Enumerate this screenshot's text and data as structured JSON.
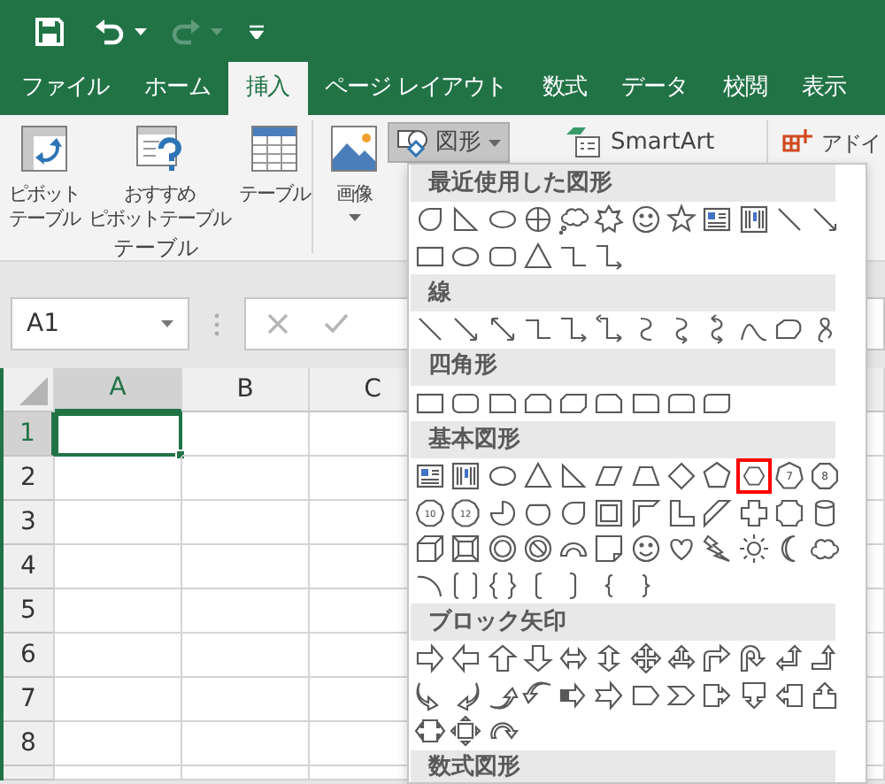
{
  "quick_access": [
    {
      "kind": "save",
      "disabled": false
    },
    {
      "kind": "undo",
      "disabled": false
    },
    {
      "kind": "redo",
      "disabled": true
    },
    {
      "kind": "customize",
      "disabled": false
    }
  ],
  "tabs": [
    {
      "label": "ファイル",
      "selected": false
    },
    {
      "label": "ホーム",
      "selected": false
    },
    {
      "label": "挿入",
      "selected": true
    },
    {
      "label": "ページ レイアウト",
      "selected": false
    },
    {
      "label": "数式",
      "selected": false
    },
    {
      "label": "データ",
      "selected": false
    },
    {
      "label": "校閲",
      "selected": false
    },
    {
      "label": "表示",
      "selected": false
    }
  ],
  "ribbon": {
    "groups": [
      {
        "label": "テーブル",
        "buttons": [
          {
            "kind": "pivot",
            "label_lines": [
              "ピボット",
              "テーブル"
            ],
            "dropdown": false,
            "pressed": false
          },
          {
            "kind": "recommended-pivot",
            "label_lines": [
              "おすすめ",
              "ピボットテーブル"
            ],
            "dropdown": false,
            "pressed": false
          },
          {
            "kind": "table",
            "label_lines": [
              "テーブル"
            ],
            "dropdown": false,
            "pressed": false
          }
        ]
      },
      {
        "buttons": [
          {
            "kind": "pictures",
            "label_lines": [
              "画像"
            ],
            "dropdown": true,
            "pressed": false
          },
          {
            "kind": "shapes",
            "label_lines": [
              "図形"
            ],
            "dropdown": true,
            "pressed": true
          },
          {
            "kind": "smartart",
            "label_lines": [
              "SmartArt"
            ],
            "dropdown": false,
            "pressed": false
          }
        ]
      },
      {
        "buttons": [
          {
            "kind": "addins",
            "label_lines": [
              "アドイ"
            ],
            "dropdown": false,
            "pressed": false
          }
        ]
      }
    ]
  },
  "formula_bar": {
    "name_box": "A1"
  },
  "sheet": {
    "columns": [
      {
        "label": "A",
        "selected": true
      },
      {
        "label": "B",
        "selected": false
      },
      {
        "label": "C",
        "selected": false
      }
    ],
    "rows": [
      {
        "label": "1",
        "selected": true
      },
      {
        "label": "2",
        "selected": false
      },
      {
        "label": "3",
        "selected": false
      },
      {
        "label": "4",
        "selected": false
      },
      {
        "label": "5",
        "selected": false
      },
      {
        "label": "6",
        "selected": false
      },
      {
        "label": "7",
        "selected": false
      },
      {
        "label": "8",
        "selected": false
      }
    ]
  },
  "shapes_menu": {
    "sections": [
      {
        "title": "最近使用した図形",
        "shapes": [
          {
            "highlighted": false
          },
          {
            "highlighted": false
          },
          {
            "highlighted": false
          },
          {
            "highlighted": false
          },
          {
            "highlighted": false
          },
          {
            "highlighted": false
          },
          {
            "highlighted": false
          },
          {
            "highlighted": false
          },
          {
            "highlighted": false
          },
          {
            "highlighted": false
          },
          {
            "highlighted": false
          },
          {
            "highlighted": false
          },
          {
            "highlighted": false
          },
          {
            "highlighted": false
          },
          {
            "highlighted": false
          },
          {
            "highlighted": false
          },
          {
            "highlighted": false
          },
          {
            "highlighted": false
          }
        ]
      },
      {
        "title": "線",
        "shapes": [
          {
            "highlighted": false
          },
          {
            "highlighted": false
          },
          {
            "highlighted": false
          },
          {
            "highlighted": false
          },
          {
            "highlighted": false
          },
          {
            "highlighted": false
          },
          {
            "highlighted": false
          },
          {
            "highlighted": false
          },
          {
            "highlighted": false
          },
          {
            "highlighted": false
          },
          {
            "highlighted": false
          },
          {
            "highlighted": false
          }
        ]
      },
      {
        "title": "四角形",
        "shapes": [
          {
            "highlighted": false
          },
          {
            "highlighted": false
          },
          {
            "highlighted": false
          },
          {
            "highlighted": false
          },
          {
            "highlighted": false
          },
          {
            "highlighted": false
          },
          {
            "highlighted": false
          },
          {
            "highlighted": false
          },
          {
            "highlighted": false
          }
        ]
      },
      {
        "title": "基本図形",
        "shapes": [
          {
            "highlighted": false
          },
          {
            "highlighted": false
          },
          {
            "highlighted": false
          },
          {
            "highlighted": false
          },
          {
            "highlighted": false
          },
          {
            "highlighted": false
          },
          {
            "highlighted": false
          },
          {
            "highlighted": false
          },
          {
            "highlighted": false
          },
          {
            "highlighted": true
          },
          {
            "highlighted": false,
            "label": "7"
          },
          {
            "highlighted": false,
            "label": "8"
          },
          {
            "highlighted": false,
            "label": "10"
          },
          {
            "highlighted": false,
            "label": "12"
          },
          {
            "highlighted": false
          },
          {
            "highlighted": false
          },
          {
            "highlighted": false
          },
          {
            "highlighted": false
          },
          {
            "highlighted": false
          },
          {
            "highlighted": false
          },
          {
            "highlighted": false
          },
          {
            "highlighted": false
          },
          {
            "highlighted": false
          },
          {
            "highlighted": false
          },
          {
            "highlighted": false
          },
          {
            "highlighted": false
          },
          {
            "highlighted": false
          },
          {
            "highlighted": false
          },
          {
            "highlighted": false
          },
          {
            "highlighted": false
          },
          {
            "highlighted": false
          },
          {
            "highlighted": false
          },
          {
            "highlighted": false
          },
          {
            "highlighted": false
          },
          {
            "highlighted": false
          },
          {
            "highlighted": false
          },
          {
            "highlighted": false
          },
          {
            "highlighted": false
          },
          {
            "highlighted": false
          },
          {
            "highlighted": false
          },
          {
            "highlighted": false
          },
          {
            "highlighted": false
          },
          {
            "highlighted": false
          }
        ]
      },
      {
        "title": "ブロック矢印",
        "shapes": [
          {
            "highlighted": false
          },
          {
            "highlighted": false
          },
          {
            "highlighted": false
          },
          {
            "highlighted": false
          },
          {
            "highlighted": false
          },
          {
            "highlighted": false
          },
          {
            "highlighted": false
          },
          {
            "highlighted": false
          },
          {
            "highlighted": false
          },
          {
            "highlighted": false
          },
          {
            "highlighted": false
          },
          {
            "highlighted": false
          },
          {
            "highlighted": false
          },
          {
            "highlighted": false
          },
          {
            "highlighted": false
          },
          {
            "highlighted": false
          },
          {
            "highlighted": false
          },
          {
            "highlighted": false
          },
          {
            "highlighted": false
          },
          {
            "highlighted": false
          },
          {
            "highlighted": false
          },
          {
            "highlighted": false
          },
          {
            "highlighted": false
          },
          {
            "highlighted": false
          },
          {
            "highlighted": false
          },
          {
            "highlighted": false
          },
          {
            "highlighted": false
          }
        ]
      },
      {
        "title": "数式図形"
      }
    ]
  }
}
